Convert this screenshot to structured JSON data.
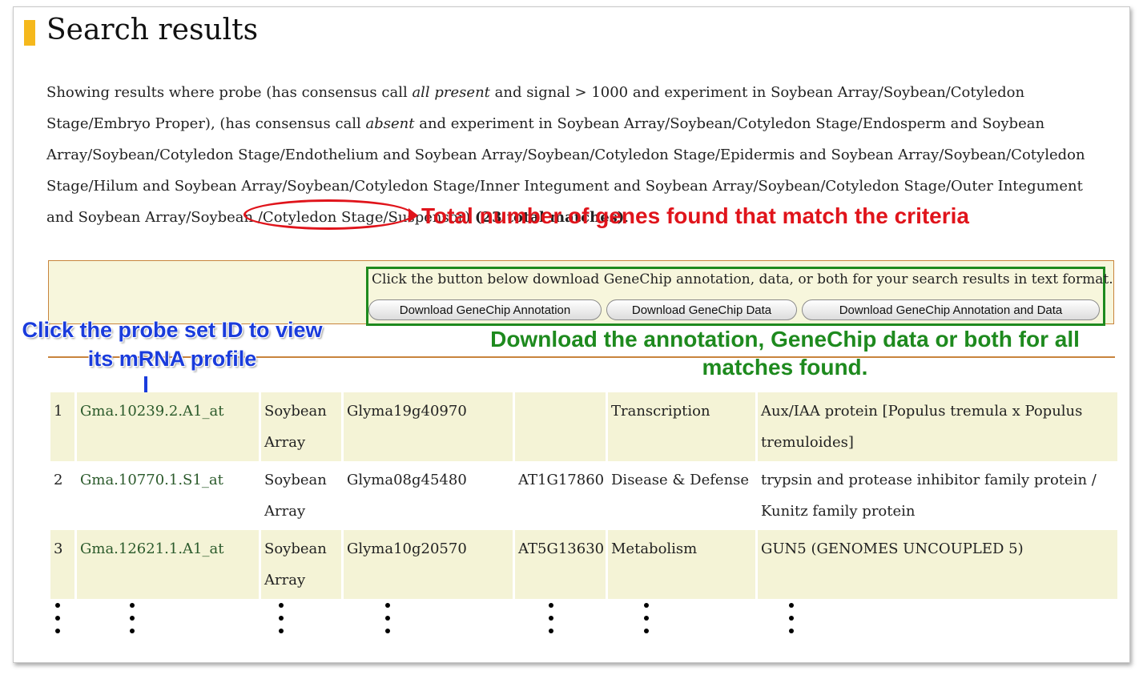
{
  "page": {
    "title": "Search results"
  },
  "summary": {
    "part1": "Showing results where probe (has consensus call ",
    "all_present": "all present",
    "part2": " and signal > 1000 and experiment in Soybean Array/Soybean/Cotyledon Stage/Embryo Proper), (has consensus call ",
    "absent": "absent",
    "part3": " and experiment in Soybean Array/Soybean/Cotyledon Stage/Endosperm and Soybean Array/Soybean/Cotyledon Stage/Endothelium and Soybean Array/Soybean/Cotyledon Stage/Epidermis and Soybean Array/Soybean/Cotyledon Stage/Hilum and Soybean Array/Soybean/Cotyledon Stage/Inner Integument and Soybean Array/Soybean/Cotyledon Stage/Outer Integument and Soybean Array/Soybean /Cotyledon Stage/Suspensor) ",
    "total_matches": "(23 total matches)",
    "period": "."
  },
  "download": {
    "message": "Click the button below download GeneChip annotation, data, or both for your search results in text format.",
    "btn_annotation": "Download GeneChip Annotation",
    "btn_data": "Download GeneChip Data",
    "btn_both": "Download GeneChip Annotation and Data"
  },
  "annotations": {
    "total": "Total number of genes found that match the criteria",
    "probe": "Click the probe set ID to view its mRNA profile",
    "download": "Download the annotation, GeneChip data or both for all matches found."
  },
  "results": [
    {
      "num": "1",
      "probe": "Gma.10239.2.A1_at",
      "array": "Soybean Array",
      "gene": "Glyma19g40970",
      "at": "",
      "category": "Transcription",
      "desc": "Aux/IAA protein [Populus tremula x Populus tremuloides]"
    },
    {
      "num": "2",
      "probe": "Gma.10770.1.S1_at",
      "array": "Soybean Array",
      "gene": "Glyma08g45480",
      "at": "AT1G17860",
      "category": "Disease & Defense",
      "desc": "trypsin and protease inhibitor family protein / Kunitz family protein"
    },
    {
      "num": "3",
      "probe": "Gma.12621.1.A1_at",
      "array": "Soybean Array",
      "gene": "Glyma10g20570",
      "at": "AT5G13630",
      "category": "Metabolism",
      "desc": "GUN5 (GENOMES UNCOUPLED 5)"
    }
  ],
  "colors": {
    "title_accent": "#f5b81c",
    "annotation_red": "#e0141b",
    "annotation_green": "#1e8a1e",
    "annotation_blue": "#1a3cdc",
    "row_highlight": "#f4f3d6",
    "panel_border": "#c8843c"
  }
}
